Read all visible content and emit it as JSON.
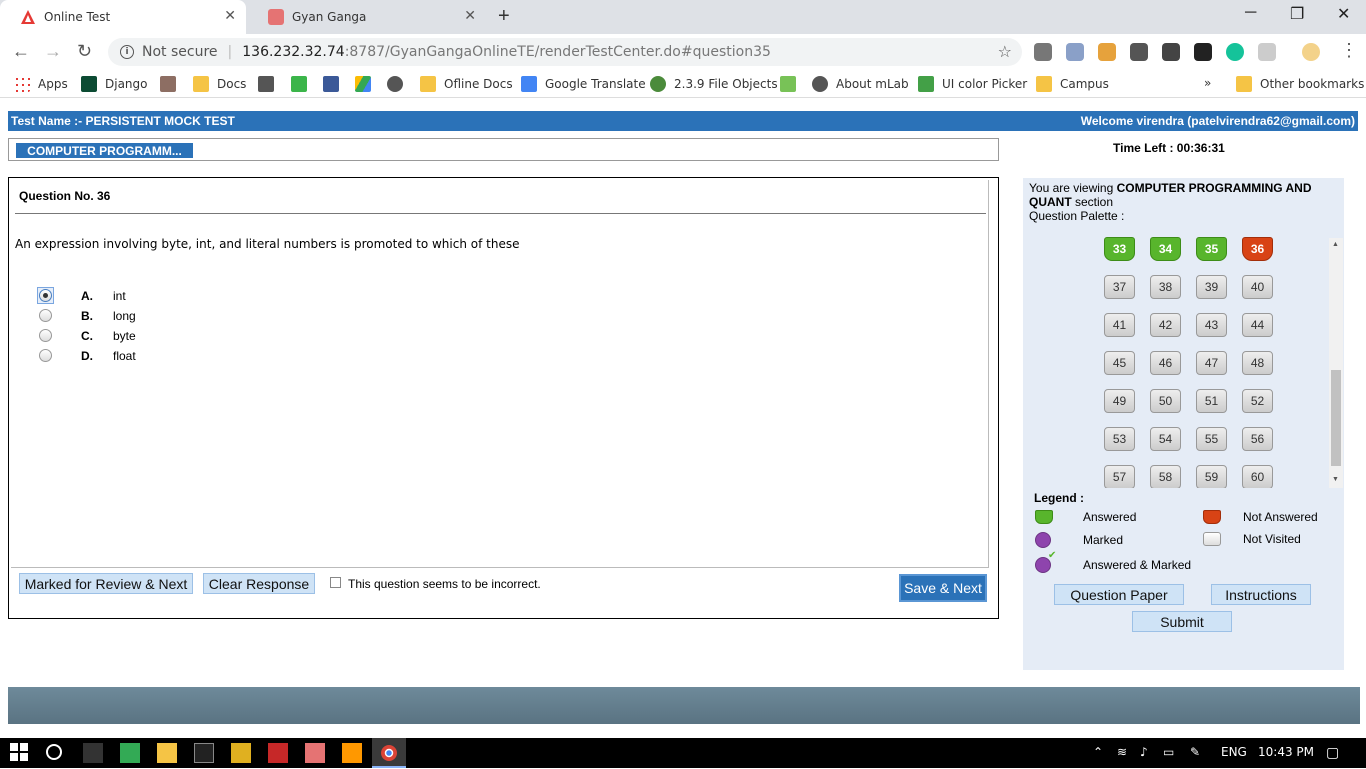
{
  "browser": {
    "tabs": [
      {
        "title": "Online Test",
        "active": true
      },
      {
        "title": "Gyan Ganga",
        "active": false
      }
    ],
    "new_tab": "+",
    "window_controls": {
      "minimize": "─",
      "maximize": "❐",
      "close": "✕"
    },
    "address": {
      "security": "Not secure",
      "host": "136.232.32.74",
      "path": ":8787/GyanGangaOnlineTE/renderTestCenter.do#question35"
    },
    "bookmarks": [
      {
        "label": "Apps"
      },
      {
        "label": "Django"
      },
      {
        "label": ""
      },
      {
        "label": "Docs"
      },
      {
        "label": ""
      },
      {
        "label": ""
      },
      {
        "label": ""
      },
      {
        "label": ""
      },
      {
        "label": ""
      },
      {
        "label": "Ofline Docs"
      },
      {
        "label": "Google Translate"
      },
      {
        "label": "2.3.9 File Objects"
      },
      {
        "label": ""
      },
      {
        "label": "About mLab"
      },
      {
        "label": "UI color Picker"
      },
      {
        "label": "Campus"
      }
    ],
    "bookmarks_more": "»",
    "other_bookmarks": "Other bookmarks"
  },
  "test": {
    "name": "Test Name :- PERSISTENT MOCK TEST",
    "welcome": "Welcome virendra (patelvirendra62@gmail.com)",
    "section_tab": "COMPUTER PROGRAMM...",
    "time_left": "Time Left : 00:36:31"
  },
  "question": {
    "number": "Question No. 36",
    "text": "An expression involving byte, int, and literal numbers is promoted to which of these",
    "options": [
      {
        "letter": "A.",
        "text": "int",
        "selected": true
      },
      {
        "letter": "B.",
        "text": "long",
        "selected": false
      },
      {
        "letter": "C.",
        "text": "byte",
        "selected": false
      },
      {
        "letter": "D.",
        "text": "float",
        "selected": false
      }
    ]
  },
  "actions": {
    "mark_review": "Marked for  Review & Next",
    "clear_response": "Clear Response",
    "incorrect_label": "This question seems to be incorrect.",
    "save_next": "Save & Next"
  },
  "right_panel": {
    "viewing_prefix": "You are viewing ",
    "viewing_section": "COMPUTER PROGRAMMING AND QUANT",
    "viewing_suffix": " section",
    "palette_label": "Question Palette :",
    "palette": [
      {
        "n": "33",
        "status": "answered"
      },
      {
        "n": "34",
        "status": "answered"
      },
      {
        "n": "35",
        "status": "answered"
      },
      {
        "n": "36",
        "status": "not-answered"
      },
      {
        "n": "37",
        "status": "not-visited"
      },
      {
        "n": "38",
        "status": "not-visited"
      },
      {
        "n": "39",
        "status": "not-visited"
      },
      {
        "n": "40",
        "status": "not-visited"
      },
      {
        "n": "41",
        "status": "not-visited"
      },
      {
        "n": "42",
        "status": "not-visited"
      },
      {
        "n": "43",
        "status": "not-visited"
      },
      {
        "n": "44",
        "status": "not-visited"
      },
      {
        "n": "45",
        "status": "not-visited"
      },
      {
        "n": "46",
        "status": "not-visited"
      },
      {
        "n": "47",
        "status": "not-visited"
      },
      {
        "n": "48",
        "status": "not-visited"
      },
      {
        "n": "49",
        "status": "not-visited"
      },
      {
        "n": "50",
        "status": "not-visited"
      },
      {
        "n": "51",
        "status": "not-visited"
      },
      {
        "n": "52",
        "status": "not-visited"
      },
      {
        "n": "53",
        "status": "not-visited"
      },
      {
        "n": "54",
        "status": "not-visited"
      },
      {
        "n": "55",
        "status": "not-visited"
      },
      {
        "n": "56",
        "status": "not-visited"
      },
      {
        "n": "57",
        "status": "not-visited"
      },
      {
        "n": "58",
        "status": "not-visited"
      },
      {
        "n": "59",
        "status": "not-visited"
      },
      {
        "n": "60",
        "status": "not-visited"
      }
    ],
    "legend_title": "Legend :",
    "legend": {
      "answered": "Answered",
      "not_answered": "Not Answered",
      "marked": "Marked",
      "not_visited": "Not Visited",
      "answered_marked": "Answered & Marked"
    },
    "question_paper": "Question Paper",
    "instructions": "Instructions",
    "submit": "Submit"
  },
  "taskbar": {
    "lang": "ENG",
    "time": "10:43 PM"
  },
  "colors": {
    "accent": "#2b72b8",
    "answered": "#58b52c",
    "not_answered": "#d84315",
    "marked": "#8e44ad",
    "panel_bg": "#e5ecf6"
  }
}
